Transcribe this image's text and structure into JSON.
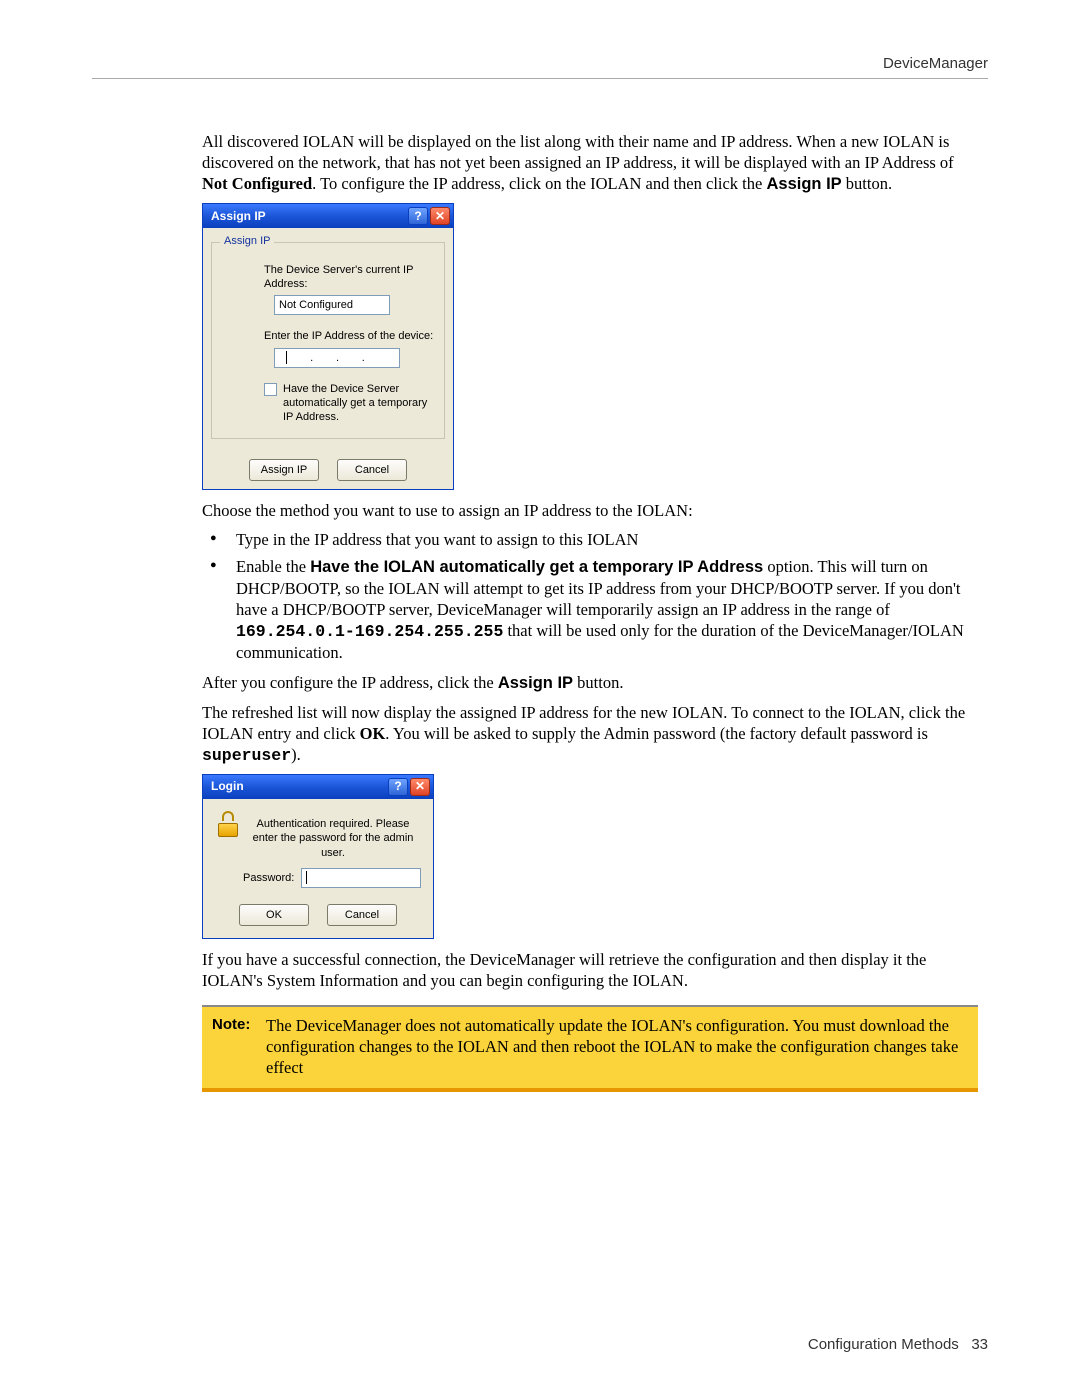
{
  "header": {
    "title": "DeviceManager"
  },
  "body": {
    "para1_a": "All discovered IOLAN will be displayed on the list along with their name and IP address. When a new IOLAN is discovered on the network, that has not yet been assigned an IP address, it will be displayed with an IP Address of ",
    "para1_bold": "Not Configured",
    "para1_b": ". To configure the IP address, click on the IOLAN and then click the ",
    "para1_button": "Assign IP",
    "para1_c": " button.",
    "para2": "Choose the method you want to use to assign an IP address to the IOLAN:",
    "bullet1": "Type in the IP address that you want to assign to this IOLAN",
    "bullet2_a": "Enable the ",
    "bullet2_bold": "Have the IOLAN automatically get a temporary IP Address",
    "bullet2_b": " option. This will turn on DHCP/BOOTP, so the IOLAN will attempt to get its IP address from your DHCP/BOOTP server. If you don't have a DHCP/BOOTP server, DeviceManager will temporarily assign an IP address in the range of ",
    "bullet2_code": "169.254.0.1-169.254.255.255",
    "bullet2_c": " that will be used only for the duration of the DeviceManager/IOLAN communication.",
    "para3_a": "After you configure the IP address, click the ",
    "para3_bold": "Assign IP",
    "para3_b": " button.",
    "para4_a": "The refreshed list will now display the assigned IP address for the new IOLAN. To connect to the IOLAN, click the IOLAN entry and click ",
    "para4_bold": "OK",
    "para4_b": ". You will be asked to supply the Admin password (the factory default password is ",
    "para4_code": "superuser",
    "para4_c": ").",
    "para5": "If you have a successful connection, the DeviceManager will retrieve the configuration and then display it the IOLAN's System Information and you can begin configuring the IOLAN."
  },
  "assign_dialog": {
    "title": "Assign IP",
    "group": "Assign IP",
    "current_label": "The Device Server's current IP Address:",
    "current_value": "Not Configured",
    "enter_label": "Enter the IP Address of the device:",
    "checkbox_label": "Have the Device Server automatically get a temporary IP Address.",
    "btn_assign": "Assign IP",
    "btn_cancel": "Cancel",
    "help": "?",
    "close": "✕"
  },
  "login_dialog": {
    "title": "Login",
    "message": "Authentication required. Please enter the password for the admin user.",
    "pw_label": "Password:",
    "btn_ok": "OK",
    "btn_cancel": "Cancel",
    "help": "?",
    "close": "✕"
  },
  "note": {
    "label": "Note:",
    "text": "The DeviceManager does not automatically update the IOLAN's configuration. You must download the configuration changes to the IOLAN and then reboot the IOLAN to make the configuration changes take effect"
  },
  "footer": {
    "section": "Configuration Methods",
    "page": "33"
  }
}
